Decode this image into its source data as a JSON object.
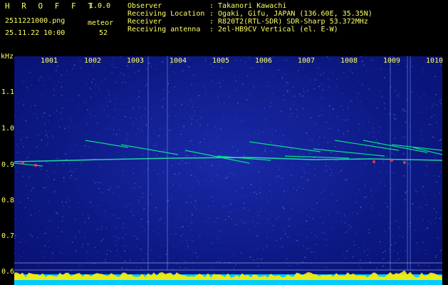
{
  "app": {
    "title": "H R O F F T",
    "version": "1.0.0"
  },
  "file": {
    "name": "2511221000.png",
    "datetime": "25.11.22 10:00"
  },
  "meteor": {
    "label": "meteor",
    "count": "52"
  },
  "info": [
    {
      "key": "Observer",
      "value": ": Takanori Kawachi"
    },
    {
      "key": "Receiving Location",
      "value": ": Ogaki, Gifu, JAPAN (136.60E, 35.35N)"
    },
    {
      "key": "Receiver",
      "value": ": R820T2(RTL-SDR) SDR-Sharp 53.372MHz"
    },
    {
      "key": "Receiving antenna",
      "value": ": 2el-HB9CV Vertical (el. E-W)"
    }
  ],
  "axes": {
    "y_unit": "kHz",
    "x_ticks": [
      "1001",
      "1002",
      "1003",
      "1004",
      "1005",
      "1006",
      "1007",
      "1008",
      "1009",
      "1010"
    ],
    "y_ticks": [
      "1.1",
      "1.0",
      "0.9",
      "0.8",
      "0.7",
      "0.6"
    ]
  },
  "colors": {
    "label": "#ffff66",
    "background": "#000000",
    "noise": "#0d1a86",
    "baseline": "#00ccff",
    "baseline_peak": "#ffee00",
    "signal": "#00ff88"
  }
}
